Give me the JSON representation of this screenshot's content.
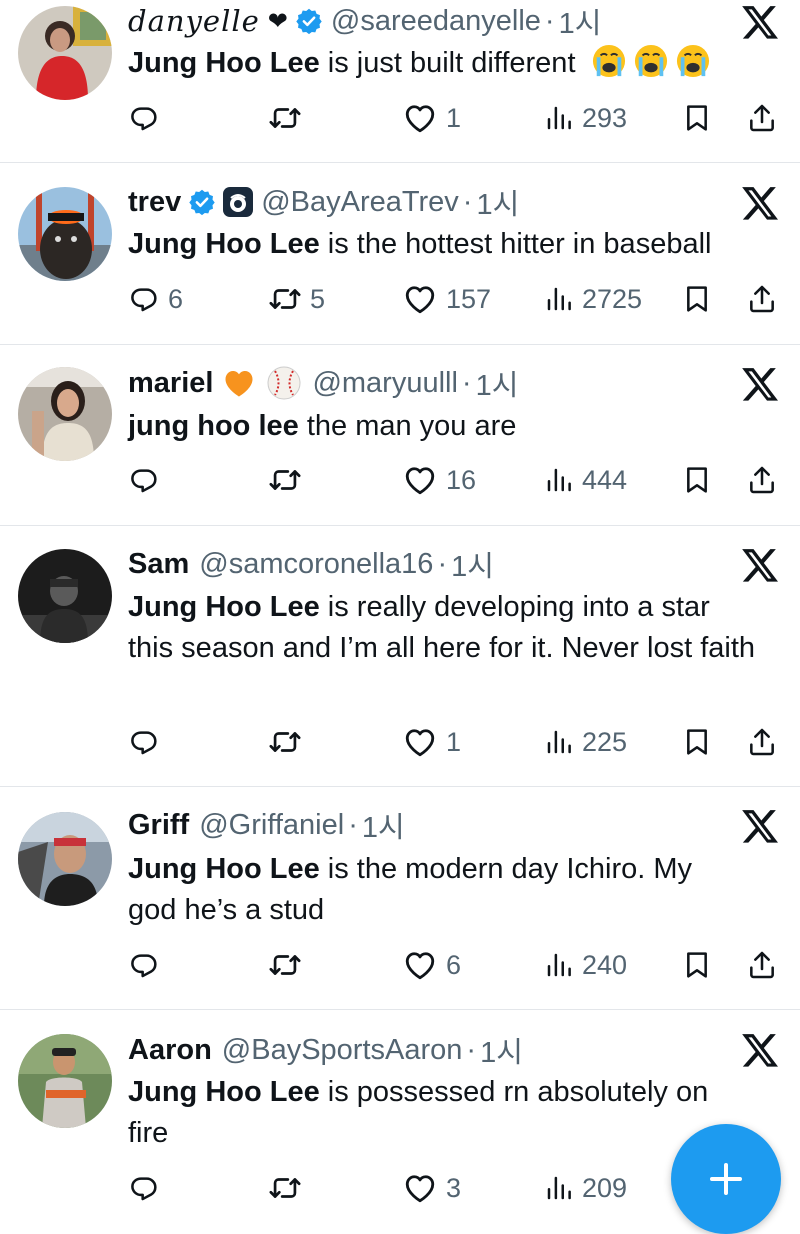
{
  "tweets": [
    {
      "name": "danyelle",
      "handle": "@sareedanyelle",
      "time": "1시",
      "highlight": "Jung Hoo Lee",
      "text": " is just built different",
      "text2": "",
      "replies": "",
      "retweets": "",
      "likes": "1",
      "views": "293"
    },
    {
      "name": "trev",
      "handle": "@BayAreaTrev",
      "time": "1시",
      "highlight": "Jung Hoo Lee",
      "text": " is the hottest hitter in baseball",
      "text2": "",
      "replies": "6",
      "retweets": "5",
      "likes": "157",
      "views": "2725"
    },
    {
      "name": "mariel",
      "handle": "@maryuulll",
      "time": "1시",
      "highlight": "jung hoo lee",
      "text": " the man you are",
      "text2": "",
      "replies": "",
      "retweets": "",
      "likes": "16",
      "views": "444"
    },
    {
      "name": "Sam",
      "handle": "@samcoronella16",
      "time": "1시",
      "highlight": "Jung Hoo Lee",
      "text": " is really developing into a star",
      "text2": "this season and I’m all here for it. Never lost faith",
      "replies": "",
      "retweets": "",
      "likes": "1",
      "views": "225"
    },
    {
      "name": "Griff",
      "handle": "@Griffaniel",
      "time": "1시",
      "highlight": "Jung Hoo Lee",
      "text": " is the modern day Ichiro. My",
      "text2": "god he’s a stud",
      "replies": "",
      "retweets": "",
      "likes": "6",
      "views": "240"
    },
    {
      "name": "Aaron",
      "handle": "@BaySportsAaron",
      "time": "1시",
      "highlight": "Jung Hoo Lee",
      "text": " is possessed rn absolutely on",
      "text2": "fire",
      "replies": "",
      "retweets": "",
      "likes": "3",
      "views": "209"
    }
  ],
  "icons": {
    "reply": "reply-icon",
    "retweet": "retweet-icon",
    "like": "like-icon",
    "views": "views-icon",
    "bookmark": "bookmark-icon",
    "share": "share-icon",
    "more": "x-logo-icon",
    "compose": "compose-plus-icon"
  },
  "colors": {
    "text": "#0f1419",
    "secondary": "#536471",
    "accent": "#1d9bf0",
    "heart_emoji": "#f7931e"
  }
}
